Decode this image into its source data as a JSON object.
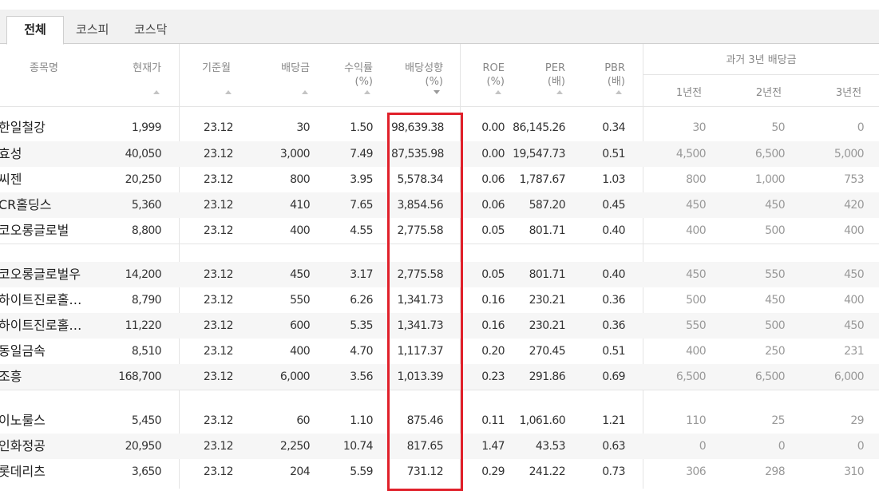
{
  "tabs": [
    "전체",
    "코스피",
    "코스닥"
  ],
  "headers": {
    "name": "종목명",
    "price": "현재가",
    "base_month": "기준월",
    "dividend": "배당금",
    "yield_line1": "수익률",
    "yield_line2": "(%)",
    "payout_line1": "배당성향",
    "payout_line2": "(%)",
    "roe_line1": "ROE",
    "roe_line2": "(%)",
    "per_line1": "PER",
    "per_line2": "(배)",
    "pbr_line1": "PBR",
    "pbr_line2": "(배)",
    "history_group": "과거 3년 배당금",
    "hist1": "1년전",
    "hist2": "2년전",
    "hist3": "3년전"
  },
  "rows": [
    {
      "name": "한일철강",
      "price": "1,999",
      "month": "23.12",
      "div": "30",
      "yield": "1.50",
      "payout": "98,639.38",
      "roe": "0.00",
      "per": "86,145.26",
      "pbr": "0.34",
      "h1": "30",
      "h2": "50",
      "h3": "0"
    },
    {
      "name": "효성",
      "price": "40,050",
      "month": "23.12",
      "div": "3,000",
      "yield": "7.49",
      "payout": "87,535.98",
      "roe": "0.00",
      "per": "19,547.73",
      "pbr": "0.51",
      "h1": "4,500",
      "h2": "6,500",
      "h3": "5,000"
    },
    {
      "name": "씨젠",
      "price": "20,250",
      "month": "23.12",
      "div": "800",
      "yield": "3.95",
      "payout": "5,578.34",
      "roe": "0.06",
      "per": "1,787.67",
      "pbr": "1.03",
      "h1": "800",
      "h2": "1,000",
      "h3": "753"
    },
    {
      "name": "CR홀딩스",
      "price": "5,360",
      "month": "23.12",
      "div": "410",
      "yield": "7.65",
      "payout": "3,854.56",
      "roe": "0.06",
      "per": "587.20",
      "pbr": "0.45",
      "h1": "450",
      "h2": "450",
      "h3": "420"
    },
    {
      "name": "코오롱글로벌",
      "price": "8,800",
      "month": "23.12",
      "div": "400",
      "yield": "4.55",
      "payout": "2,775.58",
      "roe": "0.05",
      "per": "801.71",
      "pbr": "0.40",
      "h1": "400",
      "h2": "500",
      "h3": "400"
    },
    {
      "name": "코오롱글로벌우",
      "price": "14,200",
      "month": "23.12",
      "div": "450",
      "yield": "3.17",
      "payout": "2,775.58",
      "roe": "0.05",
      "per": "801.71",
      "pbr": "0.40",
      "h1": "450",
      "h2": "550",
      "h3": "450"
    },
    {
      "name": "하이트진로홀…",
      "price": "8,790",
      "month": "23.12",
      "div": "550",
      "yield": "6.26",
      "payout": "1,341.73",
      "roe": "0.16",
      "per": "230.21",
      "pbr": "0.36",
      "h1": "500",
      "h2": "450",
      "h3": "400"
    },
    {
      "name": "하이트진로홀…",
      "price": "11,220",
      "month": "23.12",
      "div": "600",
      "yield": "5.35",
      "payout": "1,341.73",
      "roe": "0.16",
      "per": "230.21",
      "pbr": "0.36",
      "h1": "550",
      "h2": "500",
      "h3": "450"
    },
    {
      "name": "동일금속",
      "price": "8,510",
      "month": "23.12",
      "div": "400",
      "yield": "4.70",
      "payout": "1,117.37",
      "roe": "0.20",
      "per": "270.45",
      "pbr": "0.51",
      "h1": "400",
      "h2": "250",
      "h3": "231"
    },
    {
      "name": "조흥",
      "price": "168,700",
      "month": "23.12",
      "div": "6,000",
      "yield": "3.56",
      "payout": "1,013.39",
      "roe": "0.23",
      "per": "291.86",
      "pbr": "0.69",
      "h1": "6,500",
      "h2": "6,500",
      "h3": "6,000"
    },
    {
      "name": "이노룰스",
      "price": "5,450",
      "month": "23.12",
      "div": "60",
      "yield": "1.10",
      "payout": "875.46",
      "roe": "0.11",
      "per": "1,061.60",
      "pbr": "1.21",
      "h1": "110",
      "h2": "25",
      "h3": "29"
    },
    {
      "name": "인화정공",
      "price": "20,950",
      "month": "23.12",
      "div": "2,250",
      "yield": "10.74",
      "payout": "817.65",
      "roe": "1.47",
      "per": "43.53",
      "pbr": "0.63",
      "h1": "0",
      "h2": "0",
      "h3": "0"
    },
    {
      "name": "롯데리츠",
      "price": "3,650",
      "month": "23.12",
      "div": "204",
      "yield": "5.59",
      "payout": "731.12",
      "roe": "0.29",
      "per": "241.22",
      "pbr": "0.73",
      "h1": "306",
      "h2": "298",
      "h3": "310"
    }
  ]
}
